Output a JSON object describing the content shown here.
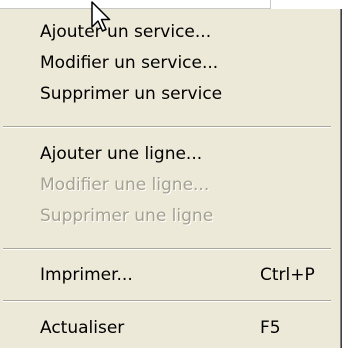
{
  "menu": {
    "items": [
      {
        "label": "Ajouter un service...",
        "shortcut": "",
        "enabled": true
      },
      {
        "label": "Modifier un service...",
        "shortcut": "",
        "enabled": true
      },
      {
        "label": "Supprimer un service",
        "shortcut": "",
        "enabled": true
      },
      {
        "label": "Ajouter une ligne...",
        "shortcut": "",
        "enabled": true
      },
      {
        "label": "Modifier une ligne...",
        "shortcut": "",
        "enabled": false
      },
      {
        "label": "Supprimer une ligne",
        "shortcut": "",
        "enabled": false
      },
      {
        "label": "Imprimer...",
        "shortcut": "Ctrl+P",
        "enabled": true
      },
      {
        "label": "Actualiser",
        "shortcut": "F5",
        "enabled": true
      }
    ]
  },
  "colors": {
    "menu_background": "#ece9d8",
    "separator_dark": "#aca899",
    "disabled_text": "#a4a28f"
  },
  "icons": {
    "cursor": "mouse-pointer-arrow-icon"
  }
}
